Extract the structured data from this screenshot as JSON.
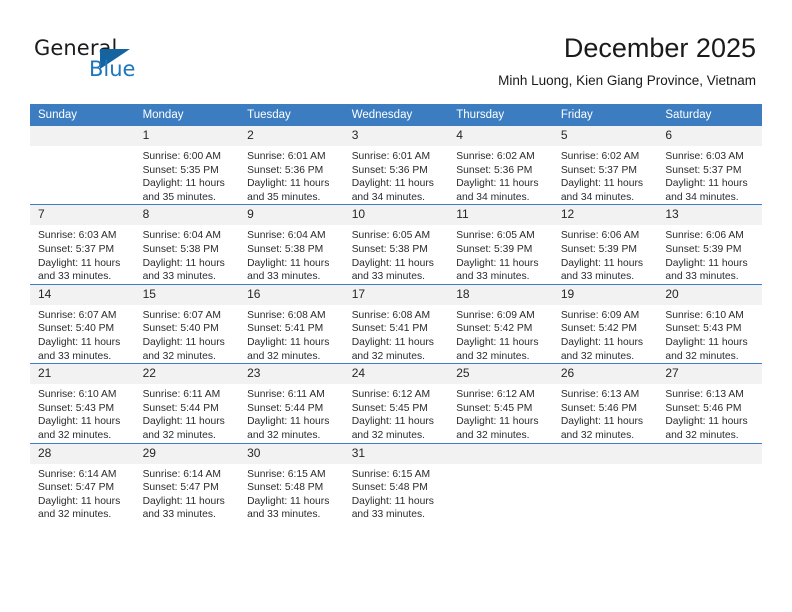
{
  "logo": {
    "word1": "General",
    "word2": "Blue",
    "triangle_color": "#15639f",
    "blue_color": "#1e76bd"
  },
  "header": {
    "title": "December 2025",
    "subtitle": "Minh Luong, Kien Giang Province, Vietnam"
  },
  "theme": {
    "header_blue": "#3b7dc0",
    "daynum_band": "#f2f2f2",
    "text": "#2b2b2b"
  },
  "weekday_headers": [
    "Sunday",
    "Monday",
    "Tuesday",
    "Wednesday",
    "Thursday",
    "Friday",
    "Saturday"
  ],
  "weeks": [
    [
      {
        "day": "",
        "lines": []
      },
      {
        "day": "1",
        "lines": [
          "Sunrise: 6:00 AM",
          "Sunset: 5:35 PM",
          "Daylight: 11 hours",
          "and 35 minutes."
        ]
      },
      {
        "day": "2",
        "lines": [
          "Sunrise: 6:01 AM",
          "Sunset: 5:36 PM",
          "Daylight: 11 hours",
          "and 35 minutes."
        ]
      },
      {
        "day": "3",
        "lines": [
          "Sunrise: 6:01 AM",
          "Sunset: 5:36 PM",
          "Daylight: 11 hours",
          "and 34 minutes."
        ]
      },
      {
        "day": "4",
        "lines": [
          "Sunrise: 6:02 AM",
          "Sunset: 5:36 PM",
          "Daylight: 11 hours",
          "and 34 minutes."
        ]
      },
      {
        "day": "5",
        "lines": [
          "Sunrise: 6:02 AM",
          "Sunset: 5:37 PM",
          "Daylight: 11 hours",
          "and 34 minutes."
        ]
      },
      {
        "day": "6",
        "lines": [
          "Sunrise: 6:03 AM",
          "Sunset: 5:37 PM",
          "Daylight: 11 hours",
          "and 34 minutes."
        ]
      }
    ],
    [
      {
        "day": "7",
        "lines": [
          "Sunrise: 6:03 AM",
          "Sunset: 5:37 PM",
          "Daylight: 11 hours",
          "and 33 minutes."
        ]
      },
      {
        "day": "8",
        "lines": [
          "Sunrise: 6:04 AM",
          "Sunset: 5:38 PM",
          "Daylight: 11 hours",
          "and 33 minutes."
        ]
      },
      {
        "day": "9",
        "lines": [
          "Sunrise: 6:04 AM",
          "Sunset: 5:38 PM",
          "Daylight: 11 hours",
          "and 33 minutes."
        ]
      },
      {
        "day": "10",
        "lines": [
          "Sunrise: 6:05 AM",
          "Sunset: 5:38 PM",
          "Daylight: 11 hours",
          "and 33 minutes."
        ]
      },
      {
        "day": "11",
        "lines": [
          "Sunrise: 6:05 AM",
          "Sunset: 5:39 PM",
          "Daylight: 11 hours",
          "and 33 minutes."
        ]
      },
      {
        "day": "12",
        "lines": [
          "Sunrise: 6:06 AM",
          "Sunset: 5:39 PM",
          "Daylight: 11 hours",
          "and 33 minutes."
        ]
      },
      {
        "day": "13",
        "lines": [
          "Sunrise: 6:06 AM",
          "Sunset: 5:39 PM",
          "Daylight: 11 hours",
          "and 33 minutes."
        ]
      }
    ],
    [
      {
        "day": "14",
        "lines": [
          "Sunrise: 6:07 AM",
          "Sunset: 5:40 PM",
          "Daylight: 11 hours",
          "and 33 minutes."
        ]
      },
      {
        "day": "15",
        "lines": [
          "Sunrise: 6:07 AM",
          "Sunset: 5:40 PM",
          "Daylight: 11 hours",
          "and 32 minutes."
        ]
      },
      {
        "day": "16",
        "lines": [
          "Sunrise: 6:08 AM",
          "Sunset: 5:41 PM",
          "Daylight: 11 hours",
          "and 32 minutes."
        ]
      },
      {
        "day": "17",
        "lines": [
          "Sunrise: 6:08 AM",
          "Sunset: 5:41 PM",
          "Daylight: 11 hours",
          "and 32 minutes."
        ]
      },
      {
        "day": "18",
        "lines": [
          "Sunrise: 6:09 AM",
          "Sunset: 5:42 PM",
          "Daylight: 11 hours",
          "and 32 minutes."
        ]
      },
      {
        "day": "19",
        "lines": [
          "Sunrise: 6:09 AM",
          "Sunset: 5:42 PM",
          "Daylight: 11 hours",
          "and 32 minutes."
        ]
      },
      {
        "day": "20",
        "lines": [
          "Sunrise: 6:10 AM",
          "Sunset: 5:43 PM",
          "Daylight: 11 hours",
          "and 32 minutes."
        ]
      }
    ],
    [
      {
        "day": "21",
        "lines": [
          "Sunrise: 6:10 AM",
          "Sunset: 5:43 PM",
          "Daylight: 11 hours",
          "and 32 minutes."
        ]
      },
      {
        "day": "22",
        "lines": [
          "Sunrise: 6:11 AM",
          "Sunset: 5:44 PM",
          "Daylight: 11 hours",
          "and 32 minutes."
        ]
      },
      {
        "day": "23",
        "lines": [
          "Sunrise: 6:11 AM",
          "Sunset: 5:44 PM",
          "Daylight: 11 hours",
          "and 32 minutes."
        ]
      },
      {
        "day": "24",
        "lines": [
          "Sunrise: 6:12 AM",
          "Sunset: 5:45 PM",
          "Daylight: 11 hours",
          "and 32 minutes."
        ]
      },
      {
        "day": "25",
        "lines": [
          "Sunrise: 6:12 AM",
          "Sunset: 5:45 PM",
          "Daylight: 11 hours",
          "and 32 minutes."
        ]
      },
      {
        "day": "26",
        "lines": [
          "Sunrise: 6:13 AM",
          "Sunset: 5:46 PM",
          "Daylight: 11 hours",
          "and 32 minutes."
        ]
      },
      {
        "day": "27",
        "lines": [
          "Sunrise: 6:13 AM",
          "Sunset: 5:46 PM",
          "Daylight: 11 hours",
          "and 32 minutes."
        ]
      }
    ],
    [
      {
        "day": "28",
        "lines": [
          "Sunrise: 6:14 AM",
          "Sunset: 5:47 PM",
          "Daylight: 11 hours",
          "and 32 minutes."
        ]
      },
      {
        "day": "29",
        "lines": [
          "Sunrise: 6:14 AM",
          "Sunset: 5:47 PM",
          "Daylight: 11 hours",
          "and 33 minutes."
        ]
      },
      {
        "day": "30",
        "lines": [
          "Sunrise: 6:15 AM",
          "Sunset: 5:48 PM",
          "Daylight: 11 hours",
          "and 33 minutes."
        ]
      },
      {
        "day": "31",
        "lines": [
          "Sunrise: 6:15 AM",
          "Sunset: 5:48 PM",
          "Daylight: 11 hours",
          "and 33 minutes."
        ]
      },
      {
        "day": "",
        "lines": []
      },
      {
        "day": "",
        "lines": []
      },
      {
        "day": "",
        "lines": []
      }
    ]
  ]
}
